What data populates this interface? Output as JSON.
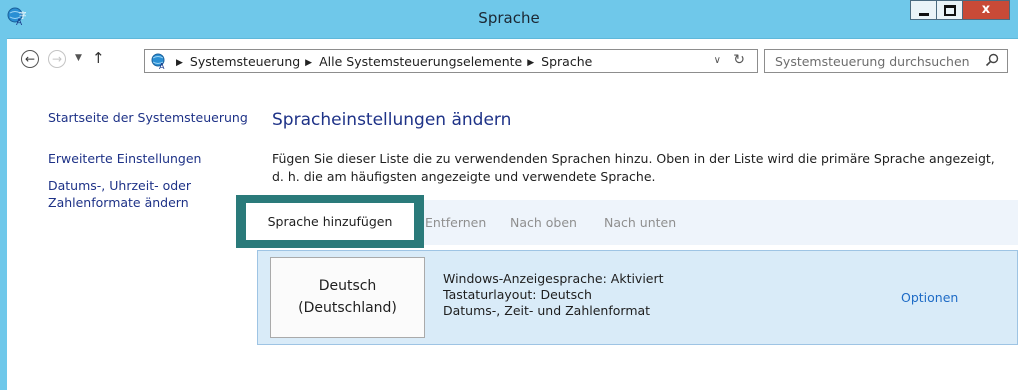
{
  "window": {
    "title": "Sprache",
    "minimize_label": "–",
    "close_label": "x"
  },
  "addressbar": {
    "breadcrumbs": [
      "Systemsteuerung",
      "Alle Systemsteuerungselemente",
      "Sprache"
    ],
    "separator": "▶",
    "dropdown_glyph": "∨",
    "refresh_glyph": "↻"
  },
  "search": {
    "placeholder": "Systemsteuerung durchsuchen"
  },
  "nav": {
    "back_glyph": "←",
    "forward_glyph": "→",
    "recent_glyph": "▼",
    "up_glyph": "↑"
  },
  "sidebar": {
    "home": "Startseite der Systemsteuerung",
    "advanced": "Erweiterte Einstellungen",
    "formats_line1": "Datums-, Uhrzeit- oder",
    "formats_line2": "Zahlenformate ändern"
  },
  "main": {
    "heading": "Spracheinstellungen ändern",
    "description_line1": "Fügen Sie dieser Liste die zu verwendenden Sprachen hinzu. Oben in der Liste wird die primäre Sprache angezeigt,",
    "description_line2": "d. h. die am häufigsten angezeigte und verwendete Sprache."
  },
  "toolbar": {
    "add": "Sprache hinzufügen",
    "remove": "Entfernen",
    "move_up": "Nach oben",
    "move_down": "Nach unten"
  },
  "language": {
    "name_line1": "Deutsch",
    "name_line2": "(Deutschland)",
    "info": [
      "Windows-Anzeigesprache: Aktiviert",
      "Tastaturlayout: Deutsch",
      "Datums-, Zeit- und Zahlenformat"
    ],
    "options": "Optionen"
  },
  "colors": {
    "titlebar": "#6fc8ea",
    "link": "#1e3287",
    "highlight": "#2a7a7a",
    "row": "#d9ebf8"
  }
}
